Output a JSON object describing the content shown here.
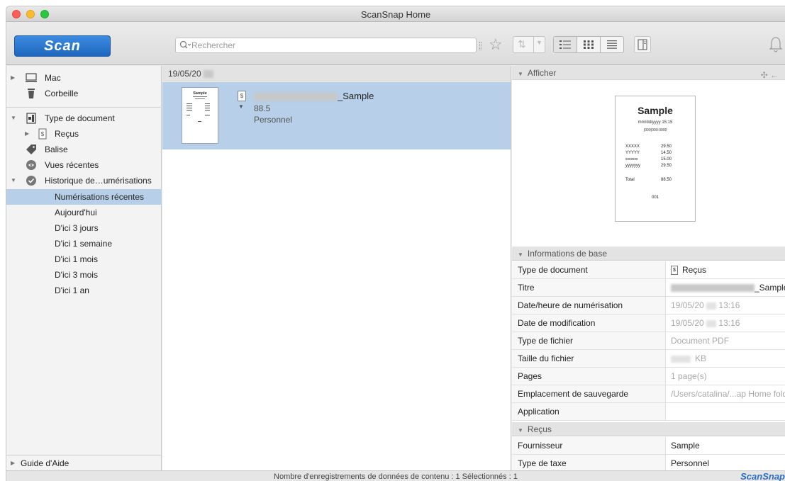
{
  "window": {
    "title": "ScanSnap Home"
  },
  "toolbar": {
    "scan_label": "Scan",
    "search_placeholder": "Rechercher"
  },
  "sidebar": {
    "mac": "Mac",
    "trash": "Corbeille",
    "doc_type": "Type de document",
    "receipts": "Reçus",
    "tag": "Balise",
    "recent_views": "Vues récentes",
    "history": "Historique de…umérisations",
    "history_items": [
      "Numérisations récentes",
      "Aujourd'hui",
      "D'ici 3 jours",
      "D'ici 1 semaine",
      "D'ici 1 mois",
      "D'ici 3 mois",
      "D'ici 1 an"
    ],
    "help": "Guide d'Aide"
  },
  "list": {
    "date_header": "19/05/20",
    "item": {
      "name_suffix": "_Sample",
      "amount": "88.5",
      "category": "Personnel"
    }
  },
  "preview": {
    "header": "Afficher",
    "receipt": {
      "title": "Sample",
      "datetime": "mm/dd/yyyy 15:15",
      "phone": "(000)000-0000",
      "lines": [
        {
          "item": "XXXXX",
          "price": "29.50"
        },
        {
          "item": "YYYYY",
          "price": "14.50"
        },
        {
          "item": "xxxxxxx",
          "price": "15.00"
        },
        {
          "item": "yyyyyyy",
          "price": "29.50"
        }
      ],
      "total_label": "Total",
      "total_value": "88.50",
      "number": "001"
    }
  },
  "basic_info": {
    "header": "Informations de base",
    "rows": [
      {
        "key": "Type de document",
        "value": "Reçus"
      },
      {
        "key": "Titre",
        "value": "_Sample"
      },
      {
        "key": "Date/heure de numérisation",
        "value_prefix": "19/05/20",
        "value_suffix": "13:16"
      },
      {
        "key": "Date de modification",
        "value_prefix": "19/05/20",
        "value_suffix": "13:16"
      },
      {
        "key": "Type de fichier",
        "value": "Document PDF"
      },
      {
        "key": "Taille du fichier",
        "value": "KB"
      },
      {
        "key": "Pages",
        "value": "1 page(s)"
      },
      {
        "key": "Emplacement de sauvegarde",
        "value": "/Users/catalina/...ap Home folder"
      },
      {
        "key": "Application",
        "value": ""
      }
    ]
  },
  "receipts_info": {
    "header": "Reçus",
    "rows": [
      {
        "key": "Fournisseur",
        "value": "Sample"
      },
      {
        "key": "Type de taxe",
        "value": "Personnel"
      }
    ]
  },
  "status": {
    "text": "Nombre d'enregistrements de données de contenu : 1  Sélectionnés : 1",
    "brand": "ScanSnap"
  }
}
